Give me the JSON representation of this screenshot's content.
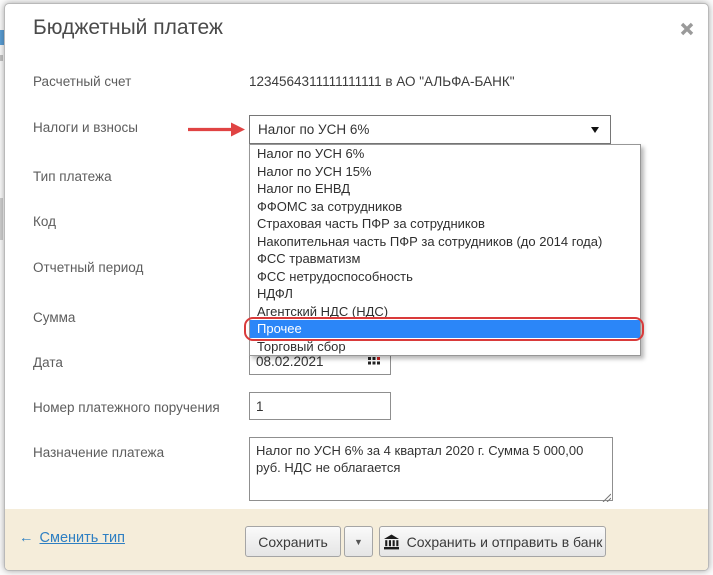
{
  "dialog": {
    "title": "Бюджетный платеж",
    "close_icon": "x-icon"
  },
  "fields": {
    "account": {
      "label": "Расчетный счет",
      "value": "1234564311111111111 в АО \"АЛЬФА-БАНК\""
    },
    "taxes": {
      "label": "Налоги и взносы",
      "selected": "Налог по УСН 6%"
    },
    "payment_type": {
      "label": "Тип платежа"
    },
    "code": {
      "label": "Код"
    },
    "period": {
      "label": "Отчетный период"
    },
    "amount": {
      "label": "Сумма"
    },
    "date": {
      "label": "Дата",
      "value": "08.02.2021"
    },
    "order_number": {
      "label": "Номер платежного поручения",
      "value": "1"
    },
    "purpose": {
      "label": "Назначение платежа",
      "value": "Налог по УСН 6% за 4 квартал 2020 г. Сумма 5 000,00 руб. НДС не облагается"
    }
  },
  "dropdown": {
    "items": [
      "Налог по УСН 6%",
      "Налог по УСН 15%",
      "Налог по ЕНВД",
      "ФФОМС за сотрудников",
      "Страховая часть ПФР за сотрудников",
      "Накопительная часть ПФР за сотрудников (до 2014 года)",
      "ФСС травматизм",
      "ФСС нетрудоспособность",
      "НДФЛ",
      "Агентский НДС (НДС)",
      "Прочее",
      "Торговый сбор"
    ],
    "highlighted_item": "Прочее",
    "highlighted_index": 10
  },
  "footer": {
    "back_arrow": "←",
    "change_type_link": "Сменить тип",
    "save_button": "Сохранить",
    "save_caret": "▼",
    "save_send_button": "Сохранить и отправить в банк"
  },
  "icons": {
    "close": "thick-x",
    "select_caret": "triangle-down",
    "annotation_arrow": "red-arrow-right",
    "calendar": "calendar-grid-with-red-dot",
    "bank": "bank-building",
    "resize": "diagonal-grip"
  },
  "colors": {
    "highlight_blue": "#2b86f8",
    "annotation_red": "#d93a3a",
    "arrow_red": "#e04343",
    "footer_bg": "#f5edda",
    "link_blue": "#2e7fc2"
  }
}
